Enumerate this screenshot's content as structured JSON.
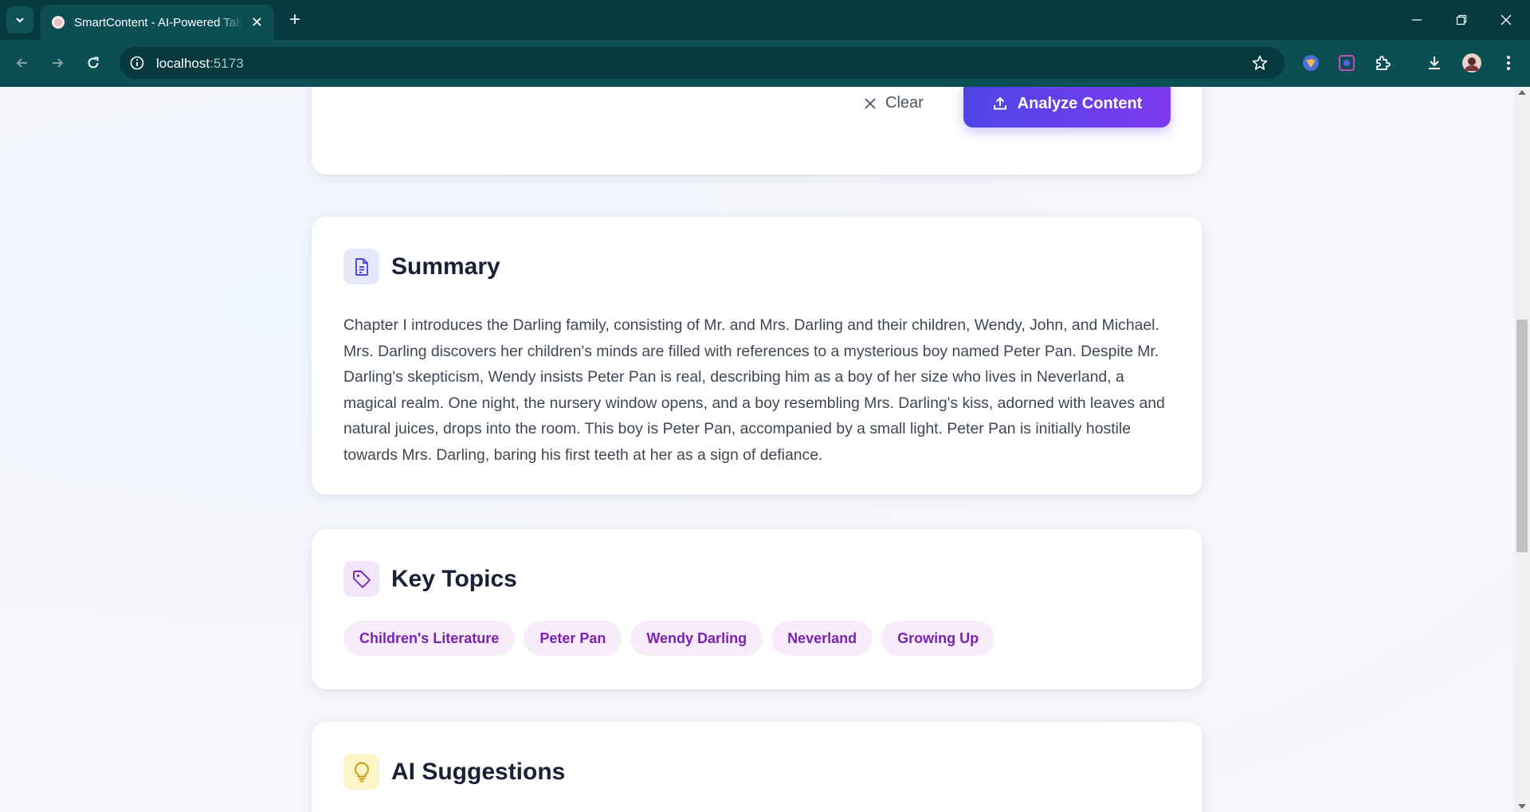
{
  "browser": {
    "tab_title": "SmartContent - AI-Powered Tab",
    "url_host": "localhost",
    "url_port": ":5173"
  },
  "actions": {
    "clear_label": "Clear",
    "analyze_label": "Analyze Content"
  },
  "summary": {
    "title": "Summary",
    "text": "Chapter I introduces the Darling family, consisting of Mr. and Mrs. Darling and their children, Wendy, John, and Michael. Mrs. Darling discovers her children's minds are filled with references to a mysterious boy named Peter Pan. Despite Mr. Darling's skepticism, Wendy insists Peter Pan is real, describing him as a boy of her size who lives in Neverland, a magical realm. One night, the nursery window opens, and a boy resembling Mrs. Darling's kiss, adorned with leaves and natural juices, drops into the room. This boy is Peter Pan, accompanied by a small light. Peter Pan is initially hostile towards Mrs. Darling, baring his first teeth at her as a sign of defiance."
  },
  "topics": {
    "title": "Key Topics",
    "items": [
      "Children's Literature",
      "Peter Pan",
      "Wendy Darling",
      "Neverland",
      "Growing Up"
    ]
  },
  "suggestions": {
    "title": "AI Suggestions"
  },
  "colors": {
    "accent_start": "#4f46e5",
    "accent_end": "#7c3aed",
    "chip_text": "#7b22b5",
    "chip_bg": "#f8ecfb"
  },
  "icons": {
    "summary": "document-icon",
    "topics": "tag-icon",
    "suggestions": "lightbulb-icon"
  }
}
